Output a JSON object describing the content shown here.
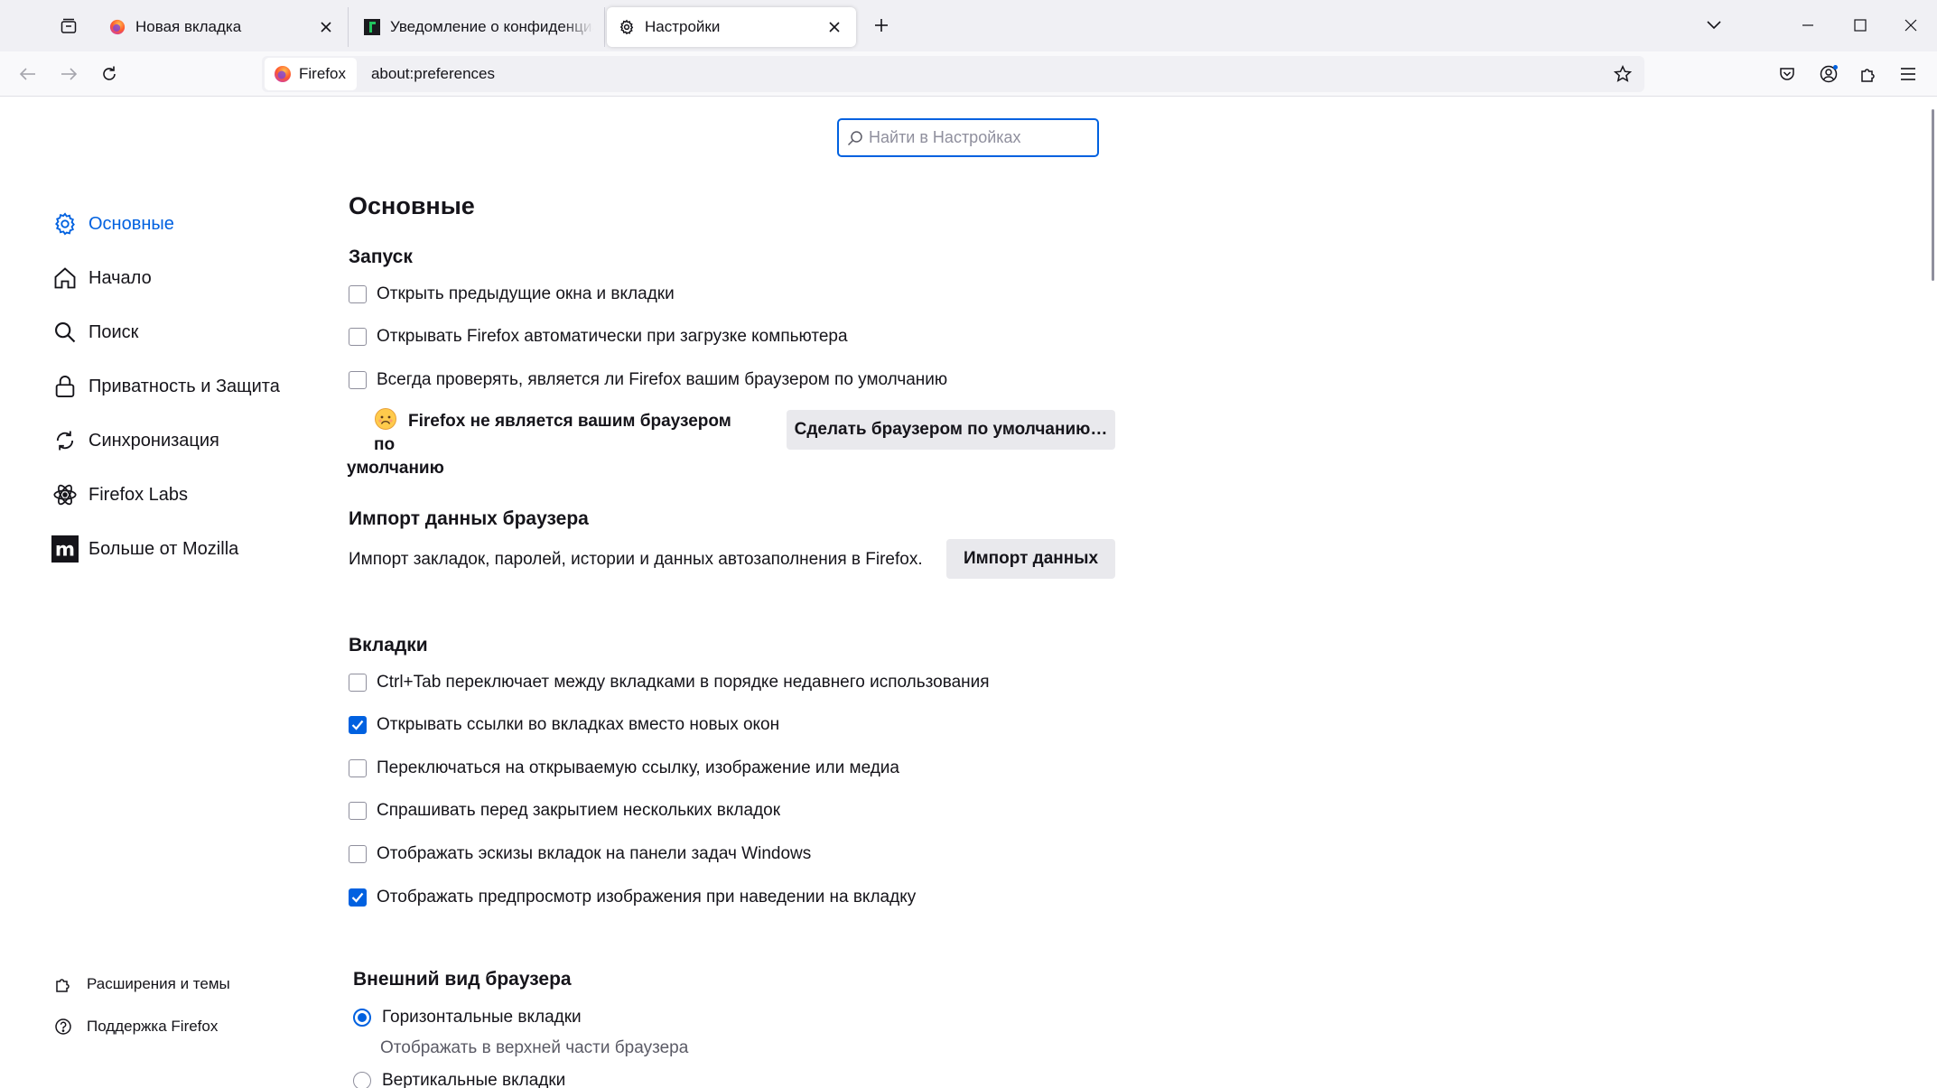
{
  "tabs": [
    {
      "title": "Новая вкладка",
      "selected": false
    },
    {
      "title": "Уведомление о конфиденциальности",
      "selected": false
    },
    {
      "title": "Настройки",
      "selected": true
    }
  ],
  "urlbar": {
    "identity_label": "Firefox",
    "url": "about:preferences"
  },
  "search": {
    "placeholder": "Найти в Настройках"
  },
  "sidebar": {
    "categories": [
      {
        "label": "Основные",
        "icon": "gear-icon",
        "selected": true
      },
      {
        "label": "Начало",
        "icon": "home-icon"
      },
      {
        "label": "Поиск",
        "icon": "search-icon"
      },
      {
        "label": "Приватность и Защита",
        "icon": "lock-icon"
      },
      {
        "label": "Синхронизация",
        "icon": "sync-icon"
      },
      {
        "label": "Firefox Labs",
        "icon": "labs-icon"
      },
      {
        "label": "Больше от Mozilla",
        "icon": "mozilla-icon"
      }
    ],
    "footer": [
      {
        "label": "Расширения и темы",
        "icon": "puzzle-icon"
      },
      {
        "label": "Поддержка Firefox",
        "icon": "help-icon"
      }
    ]
  },
  "main": {
    "title": "Основные",
    "startup": {
      "heading": "Запуск",
      "options": [
        {
          "label": "Открыть предыдущие окна и вкладки",
          "checked": false
        },
        {
          "label": "Открывать Firefox автоматически при загрузке компьютера",
          "checked": false
        },
        {
          "label": "Всегда проверять, является ли Firefox вашим браузером по умолчанию",
          "checked": false
        }
      ],
      "default_notice_line1": "Firefox не является вашим браузером по",
      "default_notice_line2": "умолчанию",
      "make_default_button": "Сделать браузером по умолчанию…"
    },
    "import": {
      "heading": "Импорт данных браузера",
      "description": "Импорт закладок, паролей, истории и данных автозаполнения в Firefox.",
      "button": "Импорт данных"
    },
    "tabs": {
      "heading": "Вкладки",
      "options": [
        {
          "label": "Ctrl+Tab переключает между вкладками в порядке недавнего использования",
          "checked": false
        },
        {
          "label": "Открывать ссылки во вкладках вместо новых окон",
          "checked": true
        },
        {
          "label": "Переключаться на открываемую ссылку, изображение или медиа",
          "checked": false
        },
        {
          "label": "Спрашивать перед закрытием нескольких вкладок",
          "checked": false
        },
        {
          "label": "Отображать эскизы вкладок на панели задач Windows",
          "checked": false
        },
        {
          "label": "Отображать предпросмотр изображения при наведении на вкладку",
          "checked": true
        }
      ]
    },
    "appearance": {
      "heading": "Внешний вид браузера",
      "options": [
        {
          "label": "Горизонтальные вкладки",
          "description": "Отображать в верхней части браузера",
          "selected": true
        },
        {
          "label": "Вертикальные вкладки",
          "selected": false
        }
      ]
    }
  },
  "colors": {
    "accent": "#0061e0",
    "tabstrip_bg": "#f0f0f4",
    "button_bg": "#e9e9ed"
  }
}
